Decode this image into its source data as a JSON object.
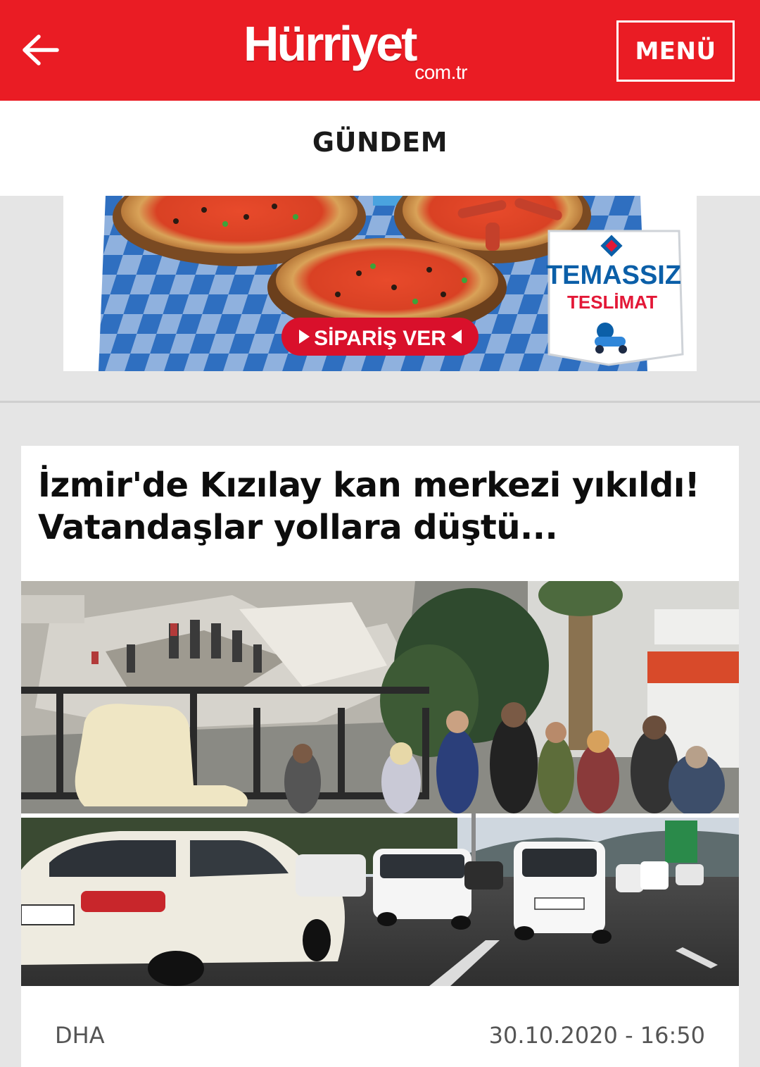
{
  "header": {
    "logo_main": "Hürriyet",
    "logo_sub": "com.tr",
    "menu_label": "MENÜ",
    "back_icon": "arrow-left-icon",
    "brand_color": "#ea1c24"
  },
  "section": {
    "title": "GÜNDEM"
  },
  "ad": {
    "badge_line1": "TEMASSIZ",
    "badge_line2": "TESLİMAT",
    "cta_label": "SİPARİŞ VER"
  },
  "article": {
    "headline": "İzmir'de Kızılay kan merkezi yıkıldı! Vatandaşlar yollara düştü...",
    "source": "DHA",
    "date": "30.10.2020 - 16:50"
  }
}
